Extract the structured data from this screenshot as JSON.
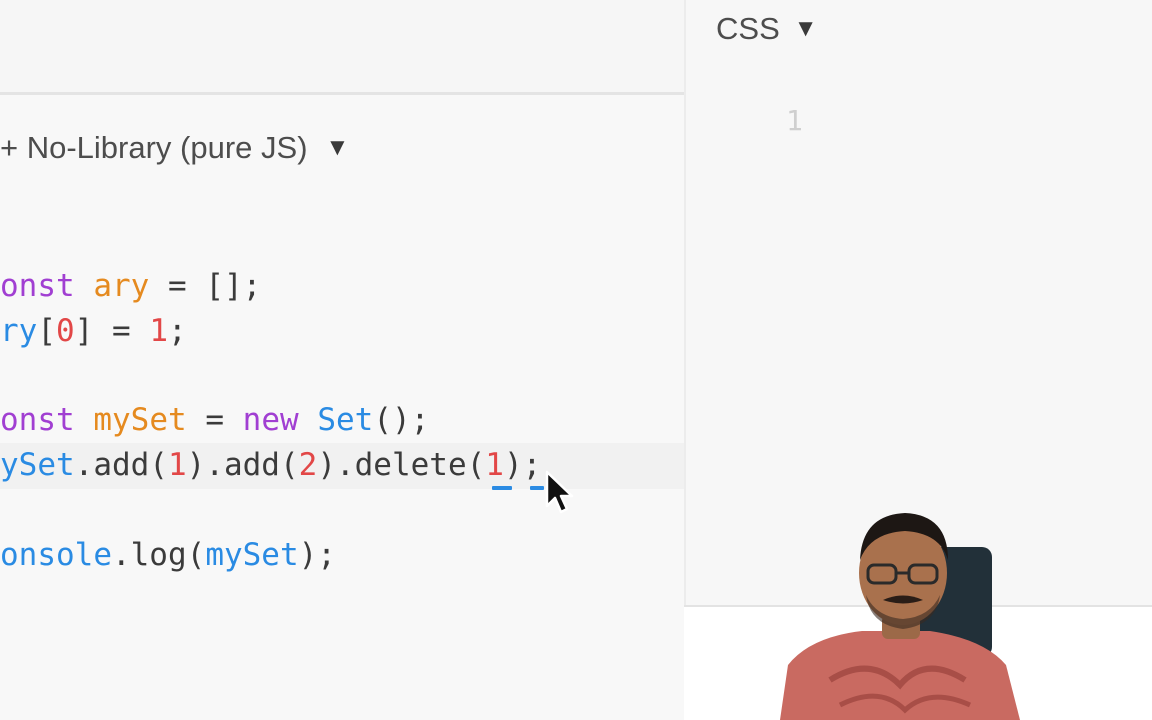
{
  "js_panel": {
    "library_label": "+ No-Library (pure JS)",
    "dropdown_icon": "triangle-down-icon",
    "code_lines": [
      [
        {
          "t": "onst ",
          "c": "kw"
        },
        {
          "t": "ary",
          "c": "var"
        },
        {
          "t": " = ",
          "c": "plain"
        },
        {
          "t": "[];",
          "c": "plain"
        }
      ],
      [
        {
          "t": "ry",
          "c": "obj"
        },
        {
          "t": "[",
          "c": "plain"
        },
        {
          "t": "0",
          "c": "num"
        },
        {
          "t": "] = ",
          "c": "plain"
        },
        {
          "t": "1",
          "c": "num"
        },
        {
          "t": ";",
          "c": "plain"
        }
      ],
      [
        {
          "t": "onst ",
          "c": "kw"
        },
        {
          "t": "mySet",
          "c": "var"
        },
        {
          "t": " = ",
          "c": "plain"
        },
        {
          "t": "new ",
          "c": "kw"
        },
        {
          "t": "Set",
          "c": "obj"
        },
        {
          "t": "();",
          "c": "plain"
        }
      ],
      [
        {
          "t": "ySet",
          "c": "obj"
        },
        {
          "t": ".add(",
          "c": "plain"
        },
        {
          "t": "1",
          "c": "num"
        },
        {
          "t": ").add(",
          "c": "plain"
        },
        {
          "t": "2",
          "c": "num"
        },
        {
          "t": ").delete(",
          "c": "plain"
        },
        {
          "t": "1",
          "c": "num"
        },
        {
          "t": ");",
          "c": "plain"
        }
      ],
      [
        {
          "t": "onsole",
          "c": "obj"
        },
        {
          "t": ".log(",
          "c": "plain"
        },
        {
          "t": "mySet",
          "c": "obj"
        },
        {
          "t": ");",
          "c": "plain"
        }
      ]
    ]
  },
  "css_panel": {
    "title": "CSS",
    "dropdown_icon": "triangle-down-icon",
    "line_number": "1"
  },
  "colors": {
    "keyword": "#a13fd2",
    "variable": "#e58a1f",
    "object": "#2a8be3",
    "number": "#e24747",
    "plain": "#3b3b3b"
  }
}
